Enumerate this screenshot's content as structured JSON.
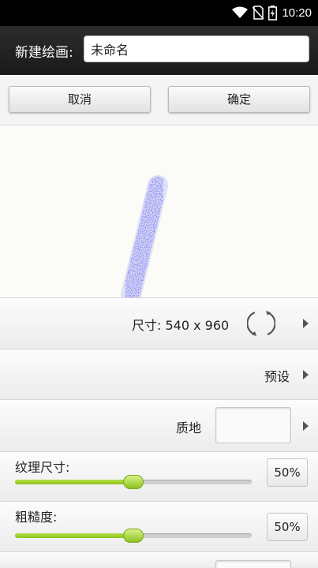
{
  "status_bar": {
    "time": "10:20",
    "icons": [
      "wifi-icon",
      "no-sim-icon",
      "battery-icon"
    ]
  },
  "header": {
    "label": "新建绘画:",
    "name_value": "未命名"
  },
  "buttons": {
    "cancel": "取消",
    "ok": "确定"
  },
  "canvas": {
    "stroke_color": "#3d3ff0"
  },
  "size_row": {
    "label": "尺寸: 540 x 960"
  },
  "preset_row": {
    "label": "预设"
  },
  "texture_row": {
    "label": "质地"
  },
  "texture_size": {
    "label": "纹理尺寸:",
    "value_text": "50%",
    "value": 0.5
  },
  "roughness": {
    "label": "粗糙度:",
    "value_text": "50%",
    "value": 0.5
  },
  "colors": {
    "accent": "#8cc21c",
    "header_bg": "#1a1a1a"
  }
}
